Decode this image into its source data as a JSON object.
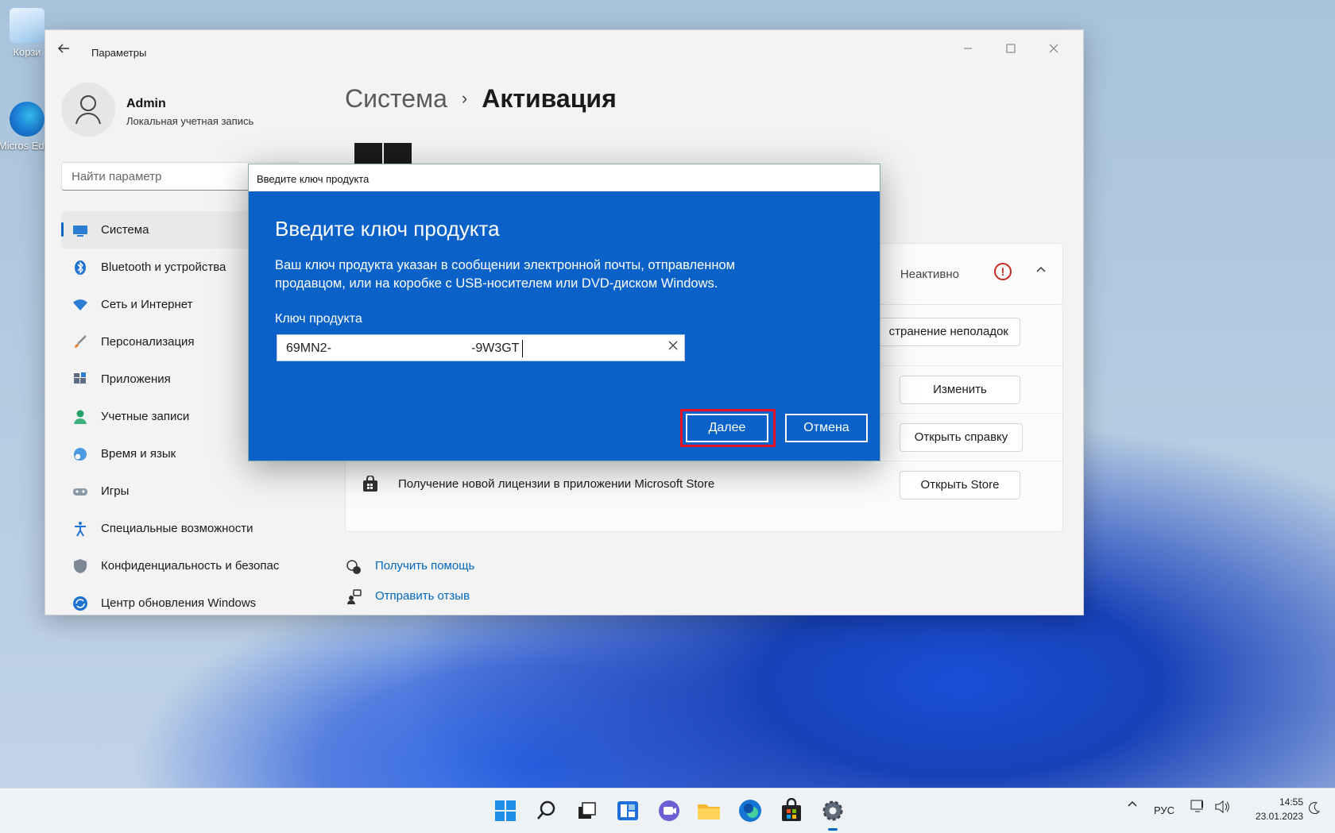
{
  "desktop": {
    "icons": [
      {
        "label": "Корзи"
      },
      {
        "label": "Micros Edge"
      }
    ]
  },
  "window": {
    "title": "Параметры",
    "profile": {
      "name": "Admin",
      "account_type": "Локальная учетная запись"
    },
    "search_placeholder": "Найти параметр",
    "nav": [
      {
        "label": "Система",
        "icon": "monitor-icon",
        "active": true
      },
      {
        "label": "Bluetooth и устройства",
        "icon": "bluetooth-icon"
      },
      {
        "label": "Сеть и Интернет",
        "icon": "wifi-icon"
      },
      {
        "label": "Персонализация",
        "icon": "brush-icon"
      },
      {
        "label": "Приложения",
        "icon": "apps-icon"
      },
      {
        "label": "Учетные записи",
        "icon": "person-icon"
      },
      {
        "label": "Время и язык",
        "icon": "globe-clock-icon"
      },
      {
        "label": "Игры",
        "icon": "gamepad-icon"
      },
      {
        "label": "Специальные возможности",
        "icon": "accessibility-icon"
      },
      {
        "label": "Конфиденциальность и безопас",
        "icon": "shield-icon"
      },
      {
        "label": "Центр обновления Windows",
        "icon": "update-icon"
      }
    ],
    "breadcrumb": {
      "parent": "Система",
      "separator": "›",
      "current": "Активация"
    },
    "activation": {
      "status": "Неактивно",
      "rows": [
        {
          "button": "странение неполадок"
        },
        {
          "button": "Изменить"
        },
        {
          "button": "Открыть справку"
        },
        {
          "text": "Получение новой лицензии в приложении Microsoft Store",
          "button": "Открыть Store"
        }
      ]
    },
    "links": {
      "help": "Получить помощь",
      "feedback": "Отправить отзыв"
    }
  },
  "dialog": {
    "window_title": "Введите ключ продукта",
    "heading": "Введите ключ продукта",
    "description": "Ваш ключ продукта указан в сообщении электронной почты, отправленном продавцом, или на коробке с USB-носителем или DVD-диском Windows.",
    "field_label": "Ключ продукта",
    "key_value_start": "69MN2-",
    "key_value_end": "-9W3GT",
    "next_label": "Далее",
    "cancel_label": "Отмена"
  },
  "taskbar": {
    "apps": [
      "start-icon",
      "search-icon",
      "task-view-icon",
      "widgets-icon",
      "chat-icon",
      "file-explorer-icon",
      "edge-icon",
      "store-icon",
      "settings-icon"
    ],
    "language": "РУС",
    "time": "14:55",
    "date": "23.01.2023"
  },
  "colors": {
    "accent": "#0067c0",
    "dialog_bg": "#0a62c9",
    "highlight": "#e81123",
    "error": "#c42b1c"
  }
}
